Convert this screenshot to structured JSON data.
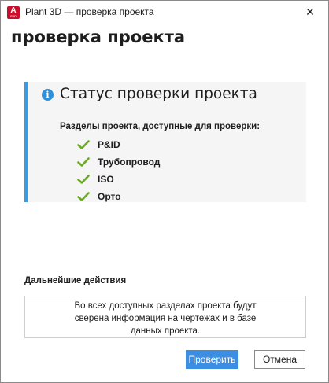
{
  "window": {
    "title": "Plant 3D — проверка проекта",
    "app_icon": "autocad-plant3d-icon",
    "app_icon_letter": "A",
    "app_icon_sub": "P3D",
    "close_glyph": "✕"
  },
  "heading": "проверка проекта",
  "status": {
    "icon": "info-icon",
    "icon_glyph": "i",
    "title": "Статус проверки проекта",
    "sections_label": "Разделы проекта, доступные для проверки:",
    "sections": [
      {
        "label": "P&ID",
        "icon": "check-icon"
      },
      {
        "label": "Трубопровод",
        "icon": "check-icon"
      },
      {
        "label": "ISO",
        "icon": "check-icon"
      },
      {
        "label": "Орто",
        "icon": "check-icon"
      }
    ]
  },
  "next_actions": {
    "label": "Дальнейшие действия",
    "lines": [
      "Во всех доступных разделах проекта будут",
      "сверена информация на чертежах и в базе",
      "данных проекта."
    ]
  },
  "buttons": {
    "check_label": "Проверить",
    "cancel_label": "Отмена"
  },
  "colors": {
    "accent_blue": "#3c8ee2",
    "panel_border": "#3c9be0",
    "check_green": "#6ea82b",
    "app_icon_red": "#c8102e"
  }
}
